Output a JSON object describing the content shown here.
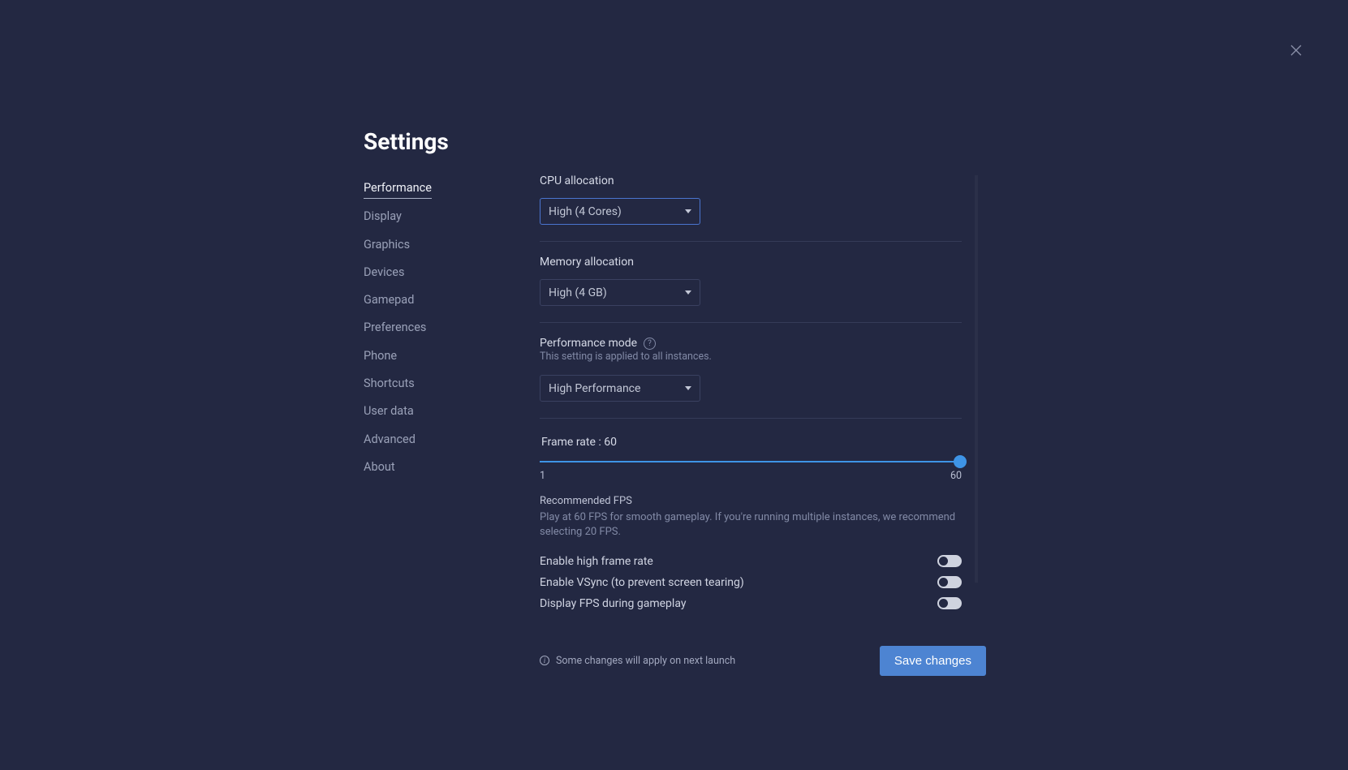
{
  "title": "Settings",
  "sidebar": {
    "items": [
      {
        "label": "Performance",
        "active": true
      },
      {
        "label": "Display",
        "active": false
      },
      {
        "label": "Graphics",
        "active": false
      },
      {
        "label": "Devices",
        "active": false
      },
      {
        "label": "Gamepad",
        "active": false
      },
      {
        "label": "Preferences",
        "active": false
      },
      {
        "label": "Phone",
        "active": false
      },
      {
        "label": "Shortcuts",
        "active": false
      },
      {
        "label": "User data",
        "active": false
      },
      {
        "label": "Advanced",
        "active": false
      },
      {
        "label": "About",
        "active": false
      }
    ]
  },
  "cpu": {
    "label": "CPU allocation",
    "value": "High (4 Cores)"
  },
  "memory": {
    "label": "Memory allocation",
    "value": "High (4 GB)"
  },
  "perfmode": {
    "label": "Performance mode",
    "sublabel": "This setting is applied to all instances.",
    "value": "High Performance"
  },
  "framerate": {
    "label_prefix": "Frame rate : ",
    "value": "60",
    "min": "1",
    "max": "60",
    "recommended_title": "Recommended FPS",
    "recommended_desc": "Play at 60 FPS for smooth gameplay. If you're running multiple instances, we recommend selecting 20 FPS."
  },
  "toggles": [
    {
      "label": "Enable high frame rate",
      "on": false
    },
    {
      "label": "Enable VSync (to prevent screen tearing)",
      "on": false
    },
    {
      "label": "Display FPS during gameplay",
      "on": false
    }
  ],
  "footer": {
    "note": "Some changes will apply on next launch",
    "save": "Save changes"
  }
}
